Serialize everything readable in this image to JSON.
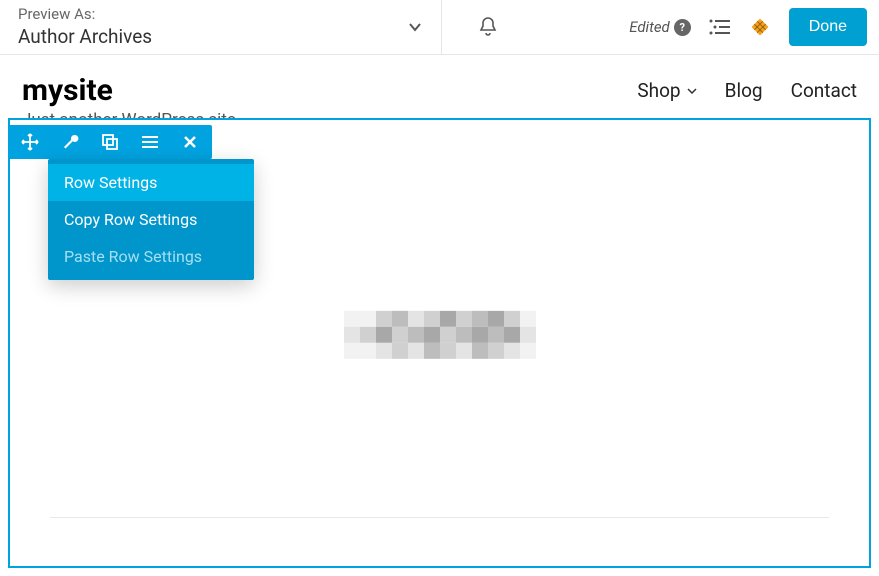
{
  "topbar": {
    "preview_label": "Preview As:",
    "preview_value": "Author Archives",
    "edited_label": "Edited",
    "done_label": "Done"
  },
  "header": {
    "site_title": "mysite",
    "tagline": "Just another WordPress site",
    "nav": [
      {
        "label": "Shop",
        "has_dropdown": true
      },
      {
        "label": "Blog",
        "has_dropdown": false
      },
      {
        "label": "Contact",
        "has_dropdown": false
      }
    ]
  },
  "context_menu": {
    "items": [
      {
        "label": "Row Settings",
        "state": "highlighted"
      },
      {
        "label": "Copy Row Settings",
        "state": "normal"
      },
      {
        "label": "Paste Row Settings",
        "state": "disabled"
      }
    ]
  },
  "colors": {
    "accent": "#00a3e0",
    "done_btn": "#00a0d2"
  }
}
